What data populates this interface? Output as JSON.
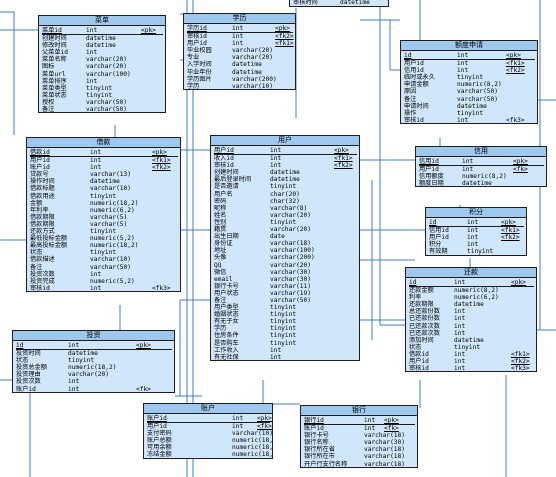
{
  "entities": [
    {
      "id": "top-partial",
      "title": "",
      "rows": [
        {
          "name": "审核时间",
          "type": "datetime",
          "key": ""
        }
      ]
    },
    {
      "id": "menu",
      "title": "菜单",
      "rows": [
        {
          "name": "菜单id",
          "type": "int",
          "key": "<pk>",
          "pk": true
        },
        {
          "name": "创建时间",
          "type": "datetime",
          "key": ""
        },
        {
          "name": "修改时间",
          "type": "datetime",
          "key": ""
        },
        {
          "name": "父菜单id",
          "type": "int",
          "key": ""
        },
        {
          "name": "菜单名称",
          "type": "varchar(20)",
          "key": ""
        },
        {
          "name": "图标",
          "type": "varchar(20)",
          "key": ""
        },
        {
          "name": "菜单url",
          "type": "varchar(100)",
          "key": ""
        },
        {
          "name": "菜单排序",
          "type": "int",
          "key": ""
        },
        {
          "name": "菜单类型",
          "type": "tinyint",
          "key": ""
        },
        {
          "name": "菜单状态",
          "type": "tinyint",
          "key": ""
        },
        {
          "name": "授权",
          "type": "varchar(50)",
          "key": ""
        },
        {
          "name": "备注",
          "type": "varchar(50)",
          "key": ""
        }
      ]
    },
    {
      "id": "education",
      "title": "学历",
      "rows": [
        {
          "name": "学历id",
          "type": "int",
          "key": "<pk>",
          "pk": true
        },
        {
          "name": "审核id",
          "type": "int",
          "key": "<fk2>"
        },
        {
          "name": "用户id",
          "type": "int",
          "key": "<fk1>"
        },
        {
          "name": "毕业校园",
          "type": "varchar(20)",
          "key": ""
        },
        {
          "name": "专业",
          "type": "varchar(20)",
          "key": ""
        },
        {
          "name": "入学时间",
          "type": "datetime",
          "key": ""
        },
        {
          "name": "毕业年份",
          "type": "datetime",
          "key": ""
        },
        {
          "name": "学历图片",
          "type": "varchar(200)",
          "key": ""
        },
        {
          "name": "学历",
          "type": "varchar(10)",
          "key": ""
        }
      ]
    },
    {
      "id": "quota-apply",
      "title": "额度申请",
      "rows": [
        {
          "name": "id",
          "type": "int",
          "key": "<pk>",
          "pk": true
        },
        {
          "name": "用户id",
          "type": "int",
          "key": "<fk1>"
        },
        {
          "name": "信用id",
          "type": "int",
          "key": "<fk2>"
        },
        {
          "name": "临时或永久",
          "type": "tinyint",
          "key": ""
        },
        {
          "name": "申请金额",
          "type": "numeric(8,2)",
          "key": ""
        },
        {
          "name": "原因",
          "type": "varchar(50)",
          "key": ""
        },
        {
          "name": "备注",
          "type": "varchar(50)",
          "key": ""
        },
        {
          "name": "申请时间",
          "type": "datetime",
          "key": ""
        },
        {
          "name": "操作",
          "type": "tinyint",
          "key": ""
        },
        {
          "name": "审核id",
          "type": "int",
          "key": "<fk3>"
        }
      ]
    },
    {
      "id": "borrow",
      "title": "借款",
      "rows": [
        {
          "name": "借款id",
          "type": "int",
          "key": "<pk>",
          "pk": true
        },
        {
          "name": "用户id",
          "type": "int",
          "key": "<fk1>"
        },
        {
          "name": "账户id",
          "type": "int",
          "key": "<fk2>"
        },
        {
          "name": "贷款号",
          "type": "varchar(13)",
          "key": ""
        },
        {
          "name": "操作时间",
          "type": "datetime",
          "key": ""
        },
        {
          "name": "借款标题",
          "type": "varchar(10)",
          "key": ""
        },
        {
          "name": "借款用途",
          "type": "tinyint",
          "key": ""
        },
        {
          "name": "金额",
          "type": "numeric(18,2)",
          "key": ""
        },
        {
          "name": "年利率",
          "type": "numeric(6,2)",
          "key": ""
        },
        {
          "name": "借款期限",
          "type": "varchar(5)",
          "key": ""
        },
        {
          "name": "借款期限",
          "type": "varchar(5)",
          "key": ""
        },
        {
          "name": "还款方式",
          "type": "tinyint",
          "key": ""
        },
        {
          "name": "最低投标金额",
          "type": "numeric(5,2)",
          "key": ""
        },
        {
          "name": "最高投标金额",
          "type": "numeric(18,2)",
          "key": ""
        },
        {
          "name": "状态",
          "type": "tinyint",
          "key": ""
        },
        {
          "name": "借款描述",
          "type": "varchar(10)",
          "key": ""
        },
        {
          "name": "备注",
          "type": "varchar(50)",
          "key": ""
        },
        {
          "name": "投资次数",
          "type": "int",
          "key": ""
        },
        {
          "name": "投资完成",
          "type": "numeric(5,2)",
          "key": ""
        },
        {
          "name": "审核id",
          "type": "int",
          "key": "<fk3>"
        }
      ]
    },
    {
      "id": "user",
      "title": "用户",
      "rows": [
        {
          "name": "用户id",
          "type": "int",
          "key": "<pk>",
          "pk": true
        },
        {
          "name": "收入id",
          "type": "int",
          "key": "<fk1>"
        },
        {
          "name": "审核id",
          "type": "int",
          "key": "<fk2>"
        },
        {
          "name": "创建时间",
          "type": "datetime",
          "key": ""
        },
        {
          "name": "最后登录时间",
          "type": "datetime",
          "key": ""
        },
        {
          "name": "是否邀请",
          "type": "tinyint",
          "key": ""
        },
        {
          "name": "用户名",
          "type": "char(20)",
          "key": ""
        },
        {
          "name": "密码",
          "type": "char(32)",
          "key": ""
        },
        {
          "name": "昵称",
          "type": "varchar(8)",
          "key": ""
        },
        {
          "name": "姓名",
          "type": "varchar(20)",
          "key": ""
        },
        {
          "name": "性别",
          "type": "tinyint",
          "key": ""
        },
        {
          "name": "籍贯",
          "type": "varchar(20)",
          "key": ""
        },
        {
          "name": "出生日期",
          "type": "date",
          "key": ""
        },
        {
          "name": "身份证",
          "type": "varchar(18)",
          "key": ""
        },
        {
          "name": "地址",
          "type": "varchar(100)",
          "key": ""
        },
        {
          "name": "头像",
          "type": "varchar(200)",
          "key": ""
        },
        {
          "name": "QQ",
          "type": "varchar(20)",
          "key": ""
        },
        {
          "name": "微信",
          "type": "varchar(30)",
          "key": ""
        },
        {
          "name": "email",
          "type": "varchar(30)",
          "key": ""
        },
        {
          "name": "银行卡号",
          "type": "varchar(11)",
          "key": ""
        },
        {
          "name": "用户状态",
          "type": "varchar(19)",
          "key": ""
        },
        {
          "name": "备注",
          "type": "varchar(50)",
          "key": ""
        },
        {
          "name": "用户类型",
          "type": "tinyint",
          "key": ""
        },
        {
          "name": "婚姻状态",
          "type": "tinyint",
          "key": ""
        },
        {
          "name": "有无子女",
          "type": "tinyint",
          "key": ""
        },
        {
          "name": "学历",
          "type": "tinyint",
          "key": ""
        },
        {
          "name": "住房条件",
          "type": "tinyint",
          "key": ""
        },
        {
          "name": "是否购车",
          "type": "tinyint",
          "key": ""
        },
        {
          "name": "工作收入",
          "type": "int",
          "key": ""
        },
        {
          "name": "有无社保",
          "type": "int",
          "key": ""
        }
      ]
    },
    {
      "id": "credit",
      "title": "信用",
      "rows": [
        {
          "name": "信用id",
          "type": "int",
          "key": "<pk>",
          "pk": true
        },
        {
          "name": "用户id",
          "type": "int",
          "key": "<fk>"
        },
        {
          "name": "信用额度",
          "type": "numeric(8,2)",
          "key": ""
        },
        {
          "name": "额度日期",
          "type": "datetime",
          "key": ""
        }
      ]
    },
    {
      "id": "points",
      "title": "积分",
      "rows": [
        {
          "name": "id",
          "type": "int",
          "key": "<pk>",
          "pk": true
        },
        {
          "name": "信用id",
          "type": "int",
          "key": "<fk1>"
        },
        {
          "name": "用户id",
          "type": "int",
          "key": "<fk2>"
        },
        {
          "name": "积分",
          "type": "int",
          "key": ""
        },
        {
          "name": "有效期",
          "type": "tinyint",
          "key": ""
        }
      ]
    },
    {
      "id": "repayment",
      "title": "还款",
      "rows": [
        {
          "name": "id",
          "type": "int",
          "key": "<pk>",
          "pk": true
        },
        {
          "name": "还款金额",
          "type": "numeric(8,2)",
          "key": ""
        },
        {
          "name": "利率",
          "type": "numeric(6,2)",
          "key": ""
        },
        {
          "name": "还款期限",
          "type": "datetime",
          "key": ""
        },
        {
          "name": "总还款份数",
          "type": "int",
          "key": ""
        },
        {
          "name": "已还款份数",
          "type": "int",
          "key": ""
        },
        {
          "name": "已还款次数",
          "type": "int",
          "key": ""
        },
        {
          "name": "已还款次数",
          "type": "int",
          "key": ""
        },
        {
          "name": "添加时间",
          "type": "datetime",
          "key": ""
        },
        {
          "name": "状态",
          "type": "tinyint",
          "key": ""
        },
        {
          "name": "借款id",
          "type": "int",
          "key": "<fk1>"
        },
        {
          "name": "用户id",
          "type": "int",
          "key": "<fk2>"
        },
        {
          "name": "审核id",
          "type": "int",
          "key": "<fk3>"
        }
      ]
    },
    {
      "id": "investment",
      "title": "投资",
      "rows": [
        {
          "name": "id",
          "type": "int",
          "key": "<pk>",
          "pk": true
        },
        {
          "name": "投资时间",
          "type": "datetime",
          "key": ""
        },
        {
          "name": "状态",
          "type": "tinyint",
          "key": ""
        },
        {
          "name": "投资总金额",
          "type": "numeric(18,2)",
          "key": ""
        },
        {
          "name": "投资理由",
          "type": "varchar(20)",
          "key": ""
        },
        {
          "name": "投资次数",
          "type": "int",
          "key": ""
        },
        {
          "name": "账户id",
          "type": "int",
          "key": "<fk>"
        }
      ]
    },
    {
      "id": "account",
      "title": "账户",
      "rows": [
        {
          "name": "账户id",
          "type": "int",
          "key": "<pk>",
          "pk": true
        },
        {
          "name": "用户id",
          "type": "int",
          "key": "<fk>"
        },
        {
          "name": "支付密码",
          "type": "varchar(10)",
          "key": ""
        },
        {
          "name": "账户总额",
          "type": "numeric(18,2)",
          "key": ""
        },
        {
          "name": "可用余额",
          "type": "numeric(18,2)",
          "key": ""
        },
        {
          "name": "冻结金额",
          "type": "numeric(18,2)",
          "key": ""
        }
      ]
    },
    {
      "id": "bank",
      "title": "银行",
      "rows": [
        {
          "name": "银行id",
          "type": "int",
          "key": "<pk>",
          "pk": true
        },
        {
          "name": "账户id",
          "type": "int",
          "key": "<fk>"
        },
        {
          "name": "银行卡号",
          "type": "varchar(18)",
          "key": ""
        },
        {
          "name": "银行名称",
          "type": "varchar(30)",
          "key": ""
        },
        {
          "name": "银行所在省",
          "type": "varchar(18)",
          "key": ""
        },
        {
          "name": "银行所在市",
          "type": "varchar(18)",
          "key": ""
        },
        {
          "name": "开户行支行名称",
          "type": "varchar(18)",
          "key": ""
        }
      ]
    }
  ]
}
